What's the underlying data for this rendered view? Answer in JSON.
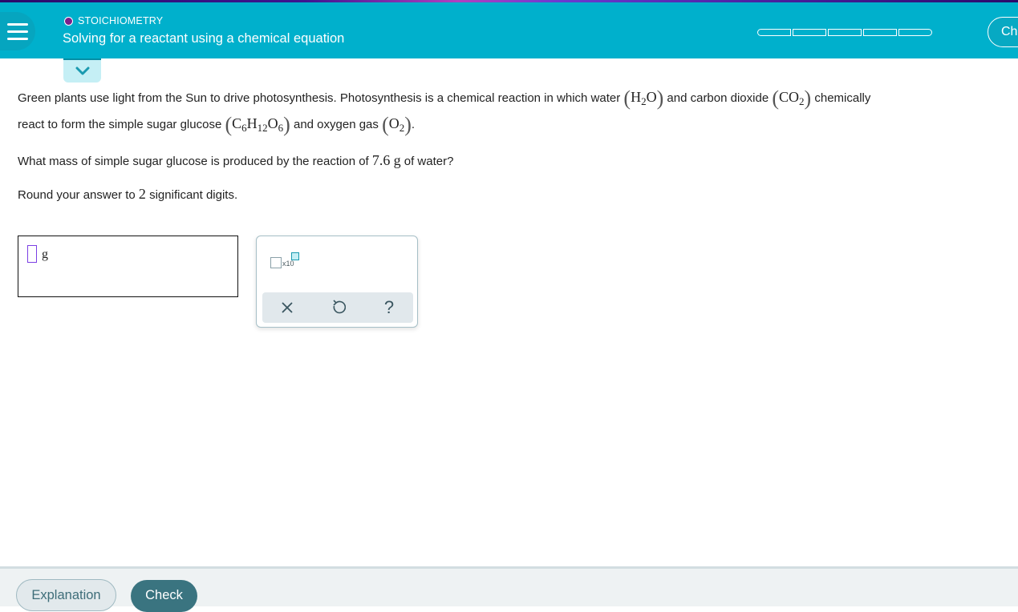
{
  "header": {
    "menu_icon": "hamburger-menu-icon",
    "topic_label": "STOICHIOMETRY",
    "topic_dot_color": "#7a1f8a",
    "title": "Solving for a reactant using a chemical equation",
    "progress_segments": 5,
    "progress_filled": 0,
    "right_button_label": "Ch",
    "accent_color": "#00b0cc"
  },
  "collapse_toggle": {
    "icon": "chevron-down-icon"
  },
  "problem": {
    "p1_a": "Green plants use light from the Sun to drive photosynthesis. Photosynthesis is a chemical reaction in which water ",
    "water_formula": {
      "H": "H",
      "sub2": "2",
      "O": "O"
    },
    "p1_b": " and carbon dioxide ",
    "co2_formula": {
      "CO": "CO",
      "sub2": "2"
    },
    "p1_c": " chemically",
    "p2_a": "react to form the simple sugar glucose ",
    "glucose_formula": {
      "C": "C",
      "sub_c": "6",
      "H": "H",
      "sub_h": "12",
      "O": "O",
      "sub_o": "6"
    },
    "p2_b": " and oxygen gas ",
    "o2_formula": {
      "O": "O",
      "sub2": "2"
    },
    "p2_c": ".",
    "question_a": "What mass of simple sugar glucose is produced by the reaction of ",
    "question_value": "7.6",
    "question_unit": "g",
    "question_b": " of water?",
    "round_a": "Round your answer to ",
    "round_digits": "2",
    "round_b": " significant digits."
  },
  "answer": {
    "value": "",
    "unit": "g"
  },
  "keypad": {
    "sci_notation_label": "x10",
    "clear_icon": "×",
    "undo_icon": "↺",
    "help_icon": "?"
  },
  "footer": {
    "explanation_label": "Explanation",
    "check_label": "Check"
  }
}
